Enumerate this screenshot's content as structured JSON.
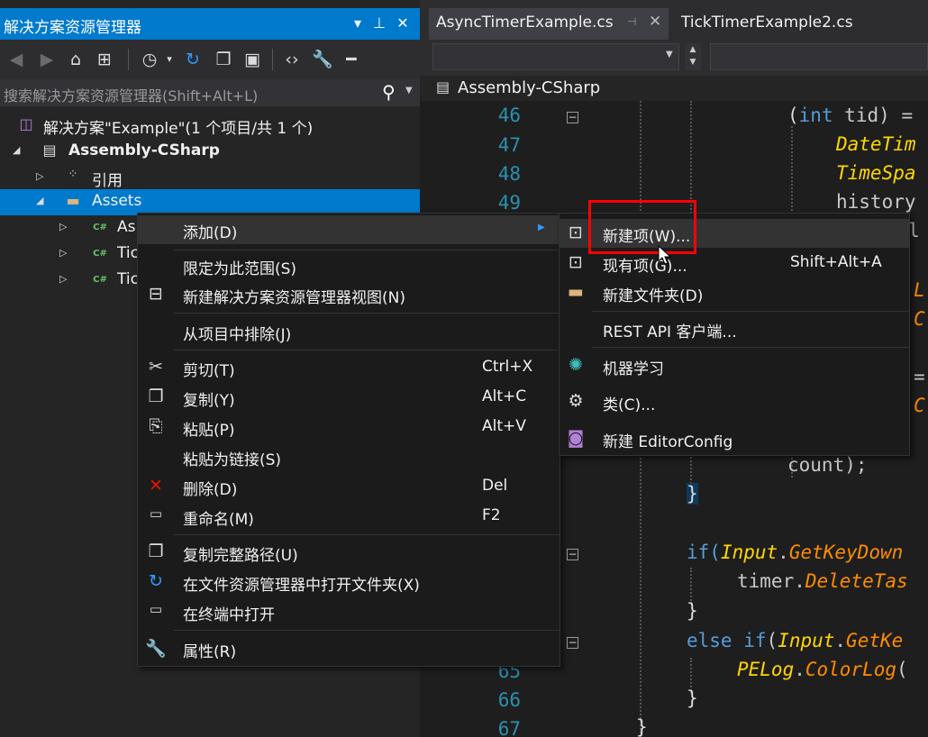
{
  "solution_explorer": {
    "title": "解决方案资源管理器",
    "title_buttons": [
      "▾",
      "⊥",
      "✕"
    ],
    "search_placeholder": "搜索解决方案资源管理器(Shift+Alt+L)",
    "tree": [
      {
        "label": "解决方案\"Example\"(1 个项目/共 1 个)",
        "icon": "solution-icon",
        "indent": 0
      },
      {
        "label": "Assembly-CSharp",
        "icon": "csharp-project-icon",
        "indent": 1,
        "bold": true
      },
      {
        "label": "引用",
        "icon": "references-icon",
        "indent": 2
      },
      {
        "label": "Assets",
        "icon": "folder-icon",
        "indent": 2,
        "selected": true
      },
      {
        "label": "As",
        "icon": "csharp-file-icon",
        "indent": 3
      },
      {
        "label": "Tic",
        "icon": "csharp-file-icon",
        "indent": 3
      },
      {
        "label": "Tic",
        "icon": "csharp-file-icon",
        "indent": 3
      }
    ]
  },
  "editor": {
    "tabs": [
      {
        "label": "AsyncTimerExample.cs",
        "active": true
      },
      {
        "label": "TickTimerExample2.cs",
        "active": false
      }
    ],
    "project_dropdown": "Assembly-CSharp",
    "line_numbers": [
      "46",
      "47",
      "48",
      "49",
      "65",
      "66",
      "67"
    ]
  },
  "code": {
    "l46": [
      "(",
      "int",
      " tid) ="
    ],
    "l47": "DateTim",
    "l48": "TimeSpa",
    "l49": "history",
    "l50": "l",
    "ll": "L",
    "lc": "C",
    "eq": "=",
    "c2": "C",
    "count": "count);",
    "brace1": "}",
    "if1": [
      "if(",
      "Input",
      ".",
      "GetKeyDown"
    ],
    "timer": [
      "timer",
      ".",
      "DeleteTas"
    ],
    "brace2": "}",
    "else": [
      "else ",
      "if",
      "(",
      "Input",
      ".",
      "GetKe"
    ],
    "pelog": [
      "PELog",
      ".",
      "ColorLog",
      "("
    ],
    "brace3": "}",
    "brace4": "}"
  },
  "context_menu": {
    "items": [
      {
        "label": "添加(D)",
        "icon": "",
        "shortcut": "",
        "submenu": true
      },
      {
        "label": "限定为此范围(S)",
        "icon": "",
        "shortcut": ""
      },
      {
        "label": "新建解决方案资源管理器视图(N)",
        "icon": "new-view-icon",
        "shortcut": ""
      },
      {
        "label": "从项目中排除(J)",
        "icon": "",
        "shortcut": ""
      },
      {
        "label": "剪切(T)",
        "icon": "scissors-icon",
        "shortcut": "Ctrl+X"
      },
      {
        "label": "复制(Y)",
        "icon": "copy-icon",
        "shortcut": "Alt+C"
      },
      {
        "label": "粘贴(P)",
        "icon": "paste-icon",
        "shortcut": "Alt+V"
      },
      {
        "label": "粘贴为链接(S)",
        "icon": "",
        "shortcut": ""
      },
      {
        "label": "删除(D)",
        "icon": "delete-icon",
        "shortcut": "Del"
      },
      {
        "label": "重命名(M)",
        "icon": "rename-icon",
        "shortcut": "F2"
      },
      {
        "label": "复制完整路径(U)",
        "icon": "copy-path-icon",
        "shortcut": ""
      },
      {
        "label": "在文件资源管理器中打开文件夹(X)",
        "icon": "refresh-folder-icon",
        "shortcut": ""
      },
      {
        "label": "在终端中打开",
        "icon": "terminal-icon",
        "shortcut": ""
      },
      {
        "label": "属性(R)",
        "icon": "wrench-icon",
        "shortcut": ""
      }
    ]
  },
  "submenu": {
    "items": [
      {
        "label": "新建项(W)...",
        "icon": "new-item-icon",
        "shortcut": ""
      },
      {
        "label": "现有项(G)...",
        "icon": "existing-item-icon",
        "shortcut": "Shift+Alt+A"
      },
      {
        "label": "新建文件夹(D)",
        "icon": "new-folder-icon",
        "shortcut": ""
      },
      {
        "label": "REST API 客户端...",
        "icon": "",
        "shortcut": ""
      },
      {
        "label": "机器学习",
        "icon": "ml-icon",
        "shortcut": ""
      },
      {
        "label": "类(C)...",
        "icon": "class-icon",
        "shortcut": ""
      },
      {
        "label": "新建 EditorConfig",
        "icon": "editorconfig-icon",
        "shortcut": ""
      }
    ]
  },
  "colors": {
    "accent": "#007acc",
    "highlight_box": "#ff0000"
  }
}
